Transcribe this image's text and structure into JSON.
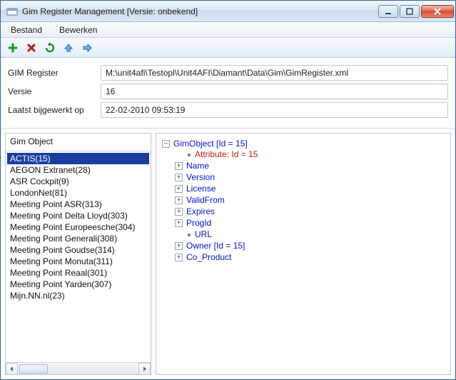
{
  "title": "Gim Register Management [Versie: onbekend]",
  "menu": {
    "bestand": "Bestand",
    "bewerken": "Bewerken"
  },
  "info": {
    "register_label": "GIM Register",
    "register_value": "M:\\unit4afi\\Testopl\\Unit4AFI\\Diamant\\Data\\Gim\\GimRegister.xml",
    "versie_label": "Versie",
    "versie_value": "16",
    "updated_label": "Laatst bijgewerkt op",
    "updated_value": "22-02-2010 09:53:19"
  },
  "list": {
    "header": "Gim Object",
    "items": [
      "ACTIS(15)",
      "AEGON Extranet(28)",
      "ASR Cockpit(9)",
      "LondonNet(81)",
      "Meeting Point ASR(313)",
      "Meeting Point Delta Lloyd(303)",
      "Meeting Point Europeesche(304)",
      "Meeting Point Generali(308)",
      "Meeting Point Goudse(314)",
      "Meeting Point Monuta(311)",
      "Meeting Point Reaal(301)",
      "Meeting Point Yarden(307)",
      "Mijn.NN.nl(23)"
    ],
    "selected_index": 0
  },
  "tree": {
    "root": "GimObject [Id = 15]",
    "attribute": "Attribute: Id = 15",
    "children": [
      {
        "label": "Name",
        "expandable": true
      },
      {
        "label": "Version",
        "expandable": true
      },
      {
        "label": "License",
        "expandable": true
      },
      {
        "label": "ValidFrom",
        "expandable": true
      },
      {
        "label": "Expires",
        "expandable": true
      },
      {
        "label": "ProgId",
        "expandable": true
      },
      {
        "label": "URL",
        "expandable": false
      },
      {
        "label": "Owner [Id = 15]",
        "expandable": true
      },
      {
        "label": "Co_Product",
        "expandable": true
      }
    ]
  },
  "icons": {
    "add": "add-icon",
    "delete": "delete-icon",
    "refresh": "refresh-icon",
    "up": "up-icon",
    "forward": "forward-icon"
  }
}
